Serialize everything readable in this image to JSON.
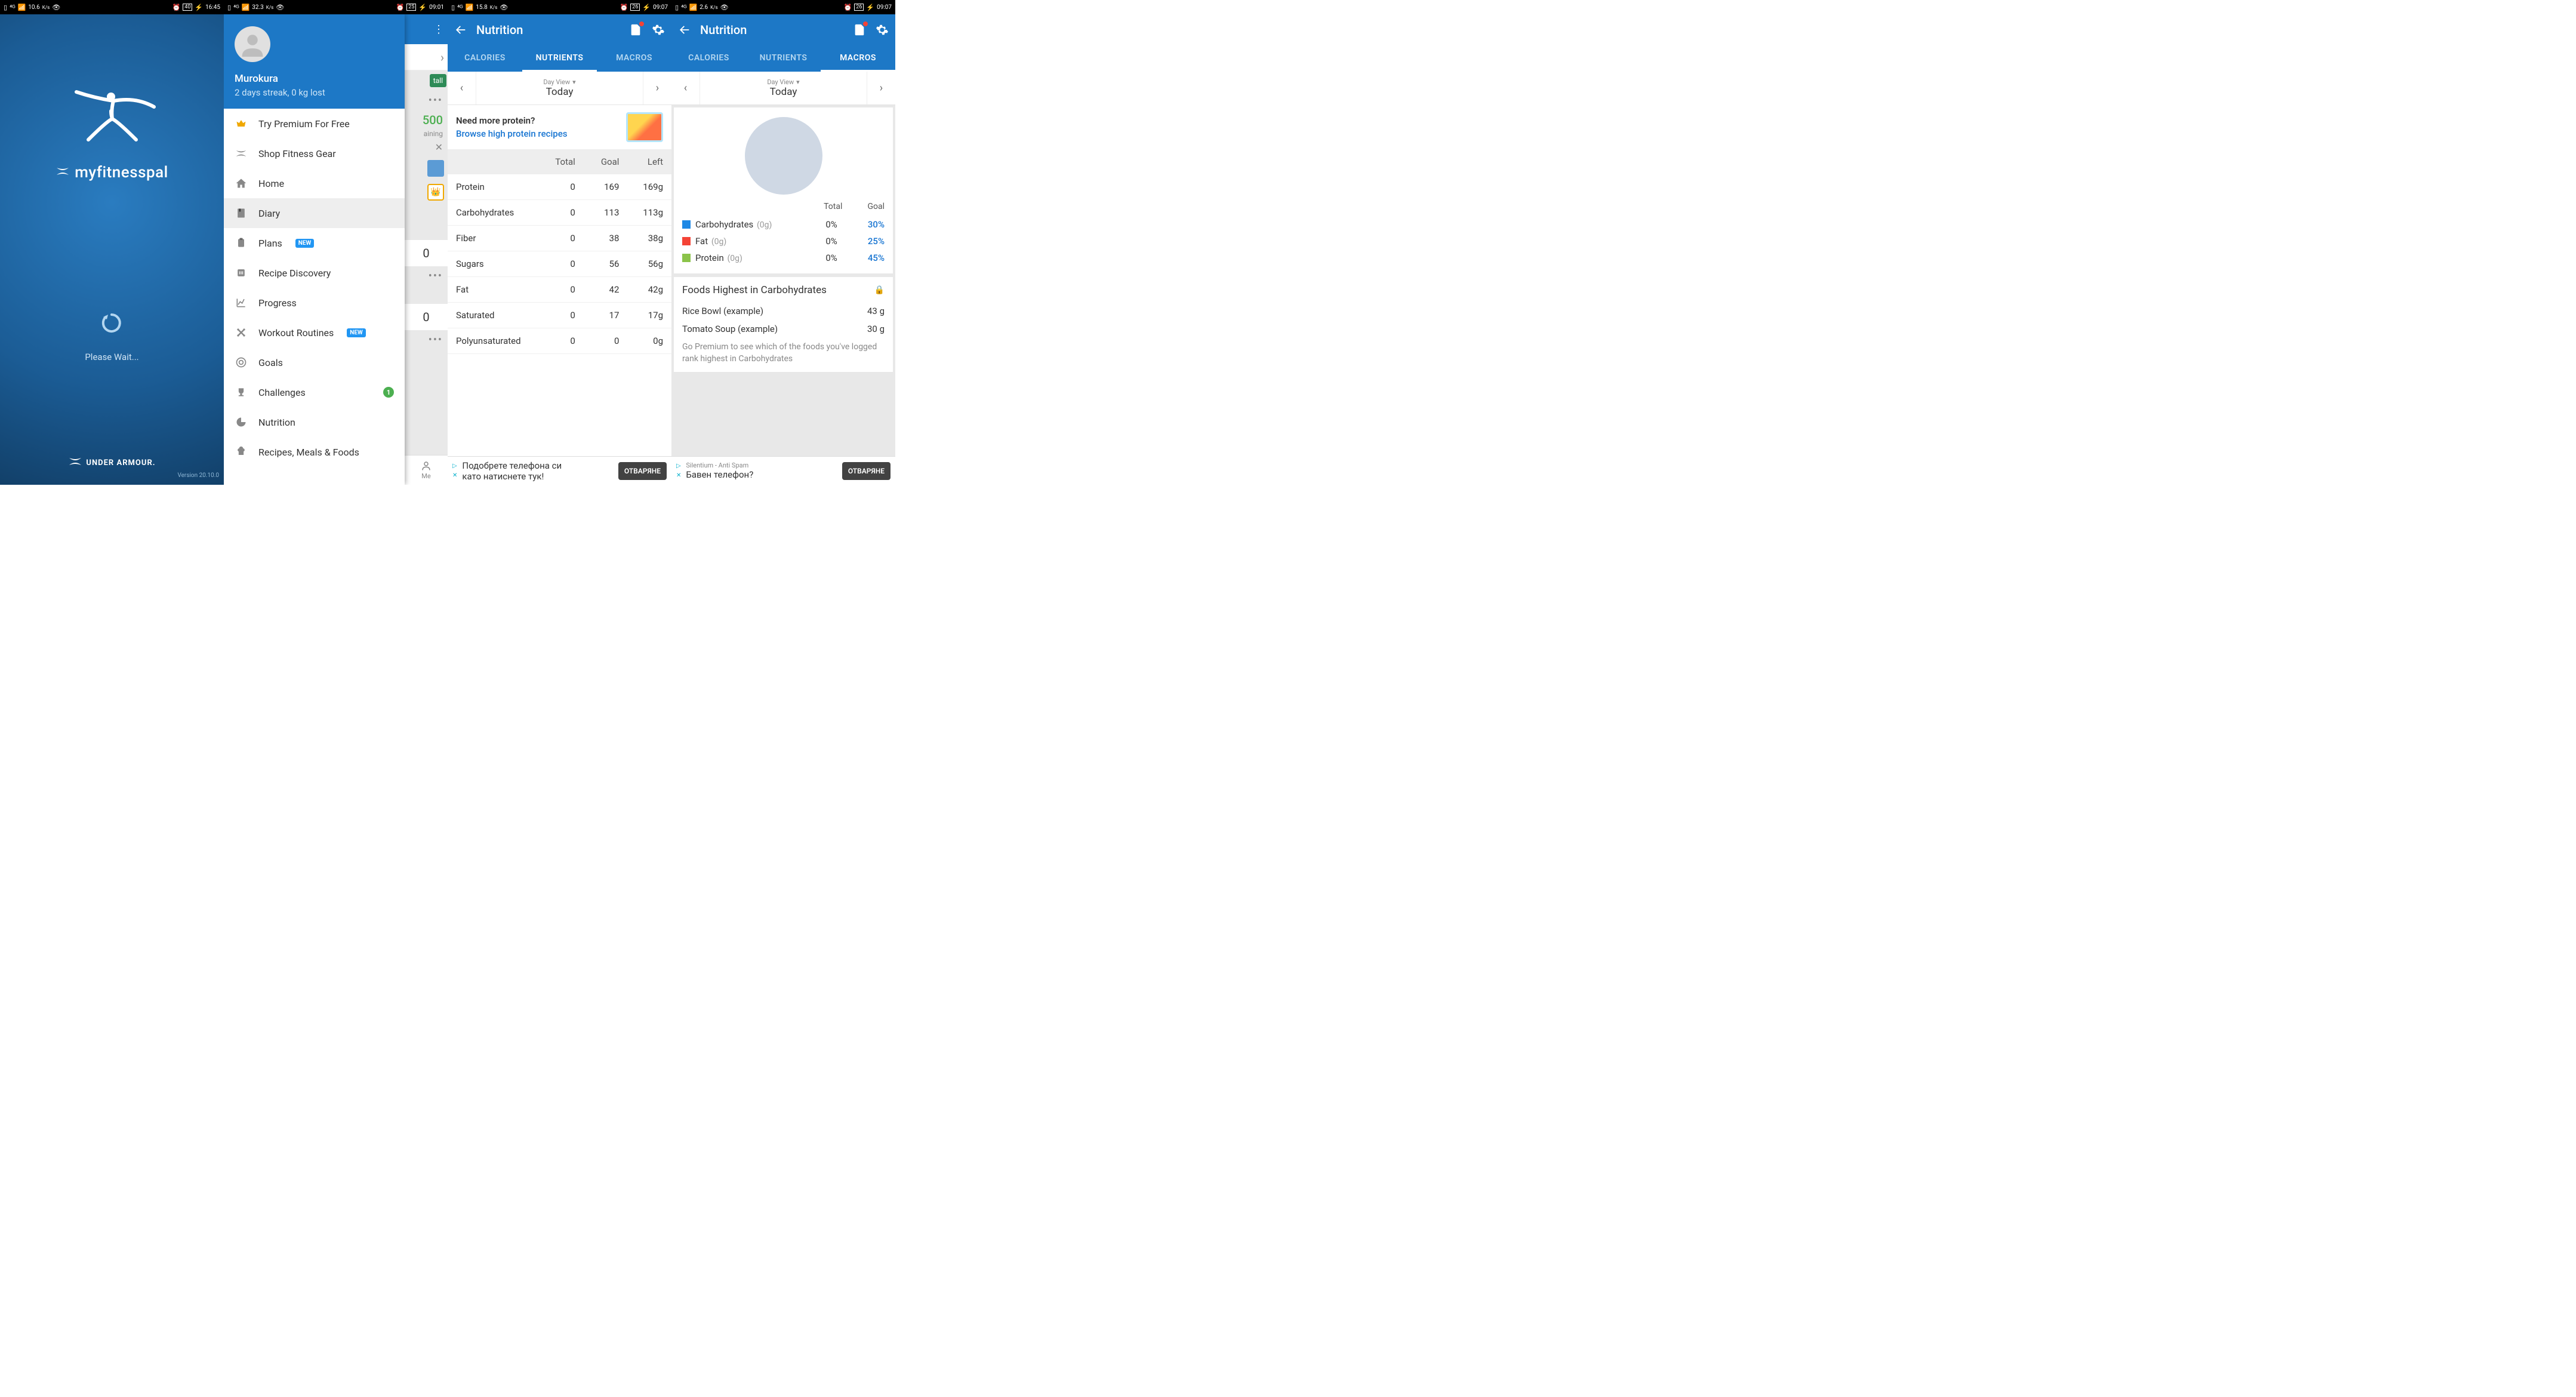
{
  "status_bars": [
    {
      "net": "10.6",
      "unit": "K/s",
      "batt": "40",
      "time": "16:45"
    },
    {
      "net": "32.3",
      "unit": "K/s",
      "batt": "25",
      "time": "09:01"
    },
    {
      "net": "15.8",
      "unit": "K/s",
      "batt": "26",
      "time": "09:07"
    },
    {
      "net": "2.6",
      "unit": "K/s",
      "batt": "26",
      "time": "09:07"
    }
  ],
  "splash": {
    "brand": "myfitnesspal",
    "wait": "Please Wait...",
    "footer": "UNDER ARMOUR.",
    "version": "Version 20.10.0"
  },
  "drawer": {
    "username": "Murokura",
    "streak": "2 days streak, 0 kg lost",
    "items": [
      {
        "label": "Try Premium For Free",
        "icon": "premium"
      },
      {
        "label": "Shop Fitness Gear",
        "icon": "ua"
      },
      {
        "label": "Home",
        "icon": "home"
      },
      {
        "label": "Diary",
        "icon": "diary",
        "active": true
      },
      {
        "label": "Plans",
        "icon": "plans",
        "badge": "NEW"
      },
      {
        "label": "Recipe Discovery",
        "icon": "recipe"
      },
      {
        "label": "Progress",
        "icon": "progress"
      },
      {
        "label": "Workout Routines",
        "icon": "workout",
        "badge": "NEW"
      },
      {
        "label": "Goals",
        "icon": "goals"
      },
      {
        "label": "Challenges",
        "icon": "challenges",
        "dot": "1"
      },
      {
        "label": "Nutrition",
        "icon": "nutrition"
      },
      {
        "label": "Recipes, Meals & Foods",
        "icon": "chef"
      }
    ],
    "back": {
      "install": "tall",
      "remaining_num": "500",
      "remaining_label": "aining",
      "zero": "0",
      "me": "Me"
    }
  },
  "nutrition_header": {
    "title": "Nutrition",
    "tabs": [
      "CALORIES",
      "NUTRIENTS",
      "MACROS"
    ],
    "date_sub": "Day View",
    "date_main": "Today"
  },
  "nutrients": {
    "promo_title": "Need more protein?",
    "promo_link": "Browse high protein recipes",
    "cols": [
      "Total",
      "Goal",
      "Left"
    ],
    "rows": [
      {
        "name": "Protein",
        "total": "0",
        "goal": "169",
        "left": "169g"
      },
      {
        "name": "Carbohydrates",
        "total": "0",
        "goal": "113",
        "left": "113g"
      },
      {
        "name": "Fiber",
        "total": "0",
        "goal": "38",
        "left": "38g"
      },
      {
        "name": "Sugars",
        "total": "0",
        "goal": "56",
        "left": "56g"
      },
      {
        "name": "Fat",
        "total": "0",
        "goal": "42",
        "left": "42g"
      },
      {
        "name": "Saturated",
        "total": "0",
        "goal": "17",
        "left": "17g"
      },
      {
        "name": "Polyunsaturated",
        "total": "0",
        "goal": "0",
        "left": "0g"
      }
    ]
  },
  "macros": {
    "head": [
      "Total",
      "Goal"
    ],
    "rows": [
      {
        "name": "Carbohydrates",
        "zero": "(0g)",
        "total": "0%",
        "goal": "30%",
        "color": "#1e88e5"
      },
      {
        "name": "Fat",
        "zero": "(0g)",
        "total": "0%",
        "goal": "25%",
        "color": "#f44336"
      },
      {
        "name": "Protein",
        "zero": "(0g)",
        "total": "0%",
        "goal": "45%",
        "color": "#8bc34a"
      }
    ],
    "foods_title": "Foods Highest in Carbohydrates",
    "foods": [
      {
        "name": "Rice Bowl (example)",
        "val": "43 g"
      },
      {
        "name": "Tomato Soup (example)",
        "val": "30 g"
      }
    ],
    "foods_note": "Go Premium to see which of the foods you've logged rank highest in Carbohydrates"
  },
  "ads": [
    {
      "line1": "Подобрете телефона си",
      "line2": "като натиснете тук!",
      "btn": "ОТВАРЯНЕ"
    },
    {
      "line1": "Silentium - Anti Spam",
      "line2": "Бавен телефон?",
      "btn": "ОТВАРЯНЕ"
    }
  ]
}
